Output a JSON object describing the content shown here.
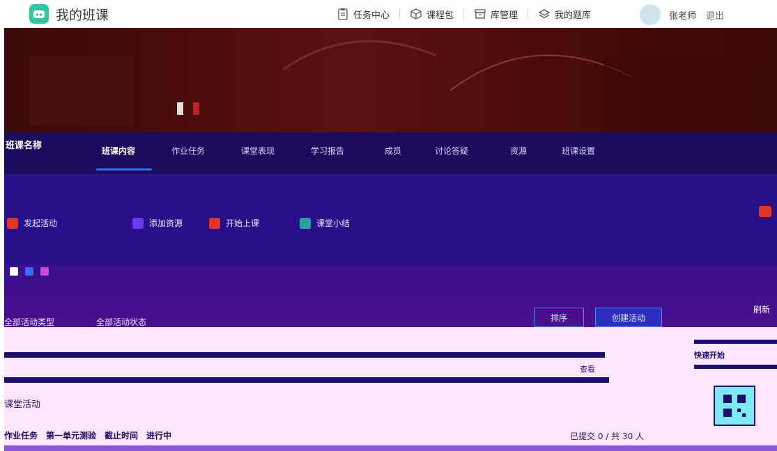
{
  "header": {
    "app_title": "我的班课",
    "nav": [
      {
        "label": "任务中心",
        "icon": "clipboard-icon"
      },
      {
        "label": "课程包",
        "icon": "package-icon"
      },
      {
        "label": "库管理",
        "icon": "archive-icon"
      },
      {
        "label": "我的题库",
        "icon": "layers-icon"
      }
    ],
    "username": "张老师",
    "logout": "退出"
  },
  "tabs": {
    "class_name": "班课名称",
    "items": [
      "班课内容",
      "作业任务",
      "课堂表现",
      "学习报告",
      "成员",
      "讨论答疑",
      "资源",
      "班课设置"
    ],
    "active_index": 0
  },
  "shortcuts": {
    "items": [
      {
        "label": "发起活动",
        "color": "#e0352b"
      },
      {
        "label": "添加资源",
        "color": "#6a3cf0"
      },
      {
        "label": "开始上课",
        "color": "#e0352b"
      },
      {
        "label": "课堂小结",
        "color": "#26a0a0"
      }
    ]
  },
  "filters": {
    "filter_a": "全部活动类型",
    "filter_b": "全部活动状态",
    "btn_sort": "排序",
    "btn_create": "创建活动",
    "refresh": "刷新"
  },
  "content": {
    "section_label": "课堂活动",
    "task_row": [
      "作业任务",
      "第一单元测验",
      "截止时间",
      "进行中"
    ],
    "task_meta": "已提交 0 / 共 30 人",
    "sub_note": "查看"
  },
  "right_panel": {
    "title": "快速开始",
    "badge": "二维码"
  }
}
